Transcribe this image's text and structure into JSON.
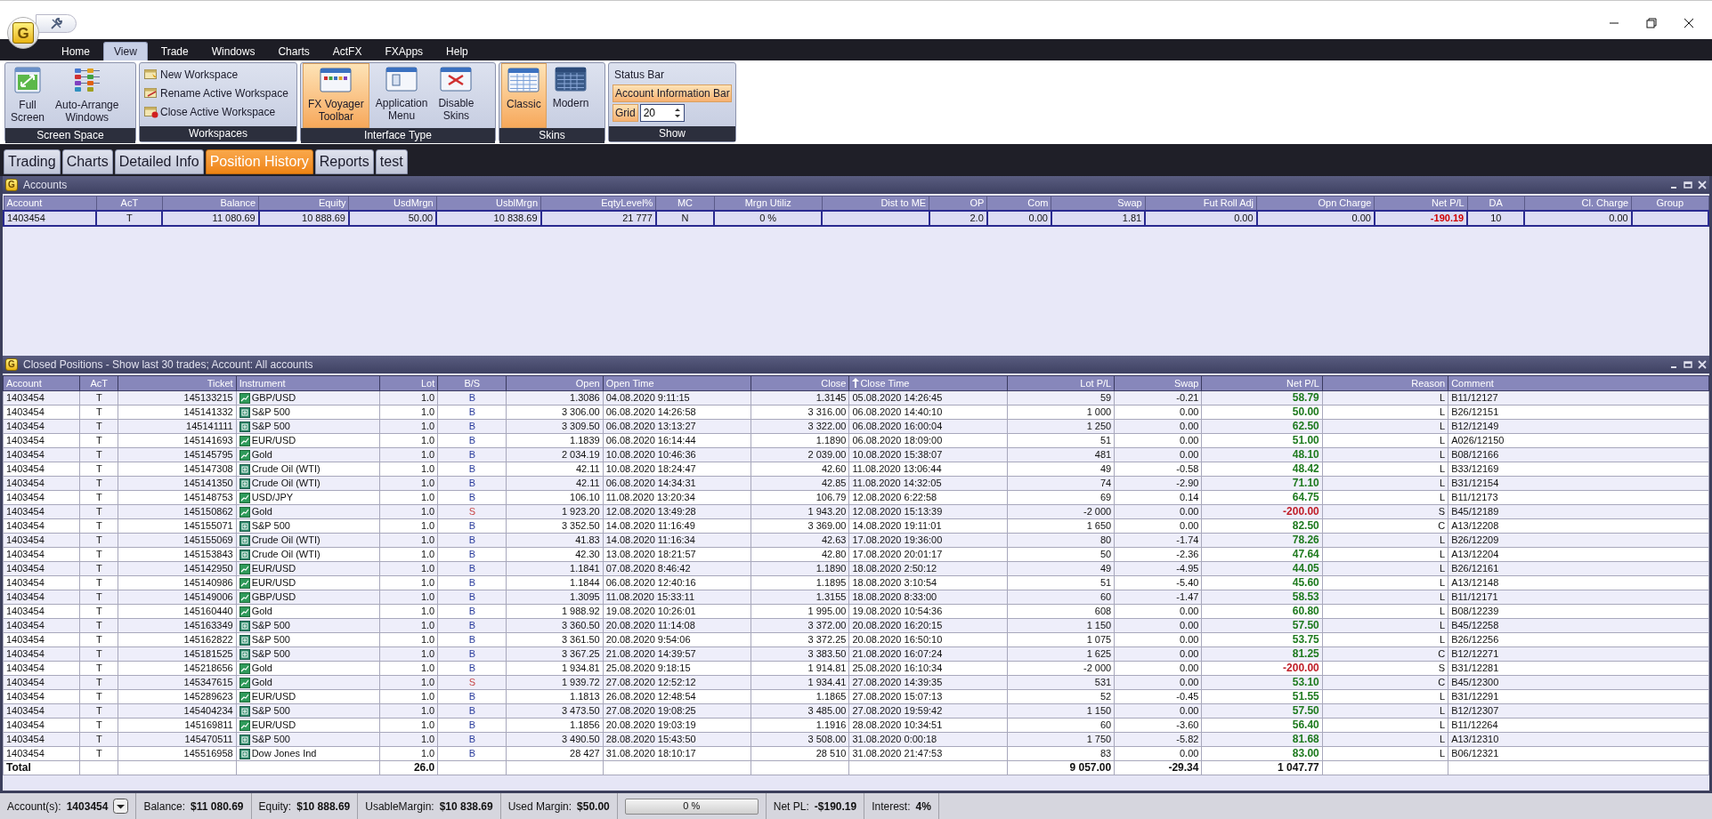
{
  "app_logo": "G",
  "menu": [
    {
      "label": "Home",
      "selected": false
    },
    {
      "label": "View",
      "selected": true
    },
    {
      "label": "Trade",
      "selected": false
    },
    {
      "label": "Windows",
      "selected": false
    },
    {
      "label": "Charts",
      "selected": false
    },
    {
      "label": "ActFX",
      "selected": false
    },
    {
      "label": "FXApps",
      "selected": false
    },
    {
      "label": "Help",
      "selected": false
    }
  ],
  "ribbon": {
    "screen_space": {
      "label": "Screen Space",
      "buttons": [
        "Full\nScreen",
        "Auto-Arrange\nWindows"
      ]
    },
    "workspaces": {
      "label": "Workspaces",
      "buttons": [
        "New Workspace",
        "Rename Active Workspace",
        "Close Active Workspace"
      ]
    },
    "interface_type": {
      "label": "Interface Type",
      "buttons": [
        {
          "label": "FX Voyager\nToolbar",
          "selected": true
        },
        {
          "label": "Application\nMenu",
          "selected": false
        },
        {
          "label": "Disable\nSkins",
          "selected": false
        }
      ]
    },
    "skins": {
      "label": "Skins",
      "buttons": [
        {
          "label": "Classic",
          "selected": true
        },
        {
          "label": "Modern",
          "selected": false
        }
      ]
    },
    "show": {
      "label": "Show",
      "toggles": [
        {
          "label": "Status Bar",
          "on": false
        },
        {
          "label": "Account Information Bar",
          "on": true
        }
      ],
      "grid": {
        "label": "Grid",
        "on": true,
        "value": "20"
      }
    }
  },
  "tabs": [
    {
      "label": "Trading",
      "selected": false
    },
    {
      "label": "Charts",
      "selected": false
    },
    {
      "label": "Detailed Info",
      "selected": false
    },
    {
      "label": "Position History",
      "selected": true
    },
    {
      "label": "Reports",
      "selected": false
    },
    {
      "label": "test",
      "selected": false
    }
  ],
  "accounts": {
    "title": "Accounts",
    "logo": "G",
    "columns": [
      "Account",
      "AcT",
      "Balance",
      "Equity",
      "UsdMrgn",
      "UsblMrgn",
      "EqtyLevel%",
      "MC",
      "Mrgn Utiliz",
      "Dist to ME",
      "OP",
      "Com",
      "Swap",
      "Fut Roll Adj",
      "Opn Charge",
      "Net P/L",
      "DA",
      "Cl. Charge",
      "Group"
    ],
    "rows": [
      {
        "selected": true,
        "loss": true,
        "cells": [
          "1403454",
          "T",
          "11 080.69",
          "10 888.69",
          "50.00",
          "10 838.69",
          "21 777",
          "N",
          "0 %",
          "",
          "2.0",
          "0.00",
          "1.81",
          "0.00",
          "0.00",
          "-190.19",
          "10",
          "0.00",
          ""
        ]
      }
    ]
  },
  "closed_positions": {
    "title": "Closed Positions - Show last 30 trades; Account: All accounts",
    "logo": "G",
    "columns": [
      {
        "label": "Account",
        "sorted": false
      },
      {
        "label": "AcT",
        "sorted": false
      },
      {
        "label": "Ticket",
        "sorted": false
      },
      {
        "label": "Instrument",
        "sorted": false
      },
      {
        "label": "Lot",
        "sorted": false
      },
      {
        "label": "B/S",
        "sorted": false
      },
      {
        "label": "Open",
        "sorted": false
      },
      {
        "label": "Open Time",
        "sorted": false
      },
      {
        "label": "Close",
        "sorted": false
      },
      {
        "label": "Close Time",
        "sorted": true
      },
      {
        "label": "Lot P/L",
        "sorted": false
      },
      {
        "label": "Swap",
        "sorted": false
      },
      {
        "label": "Net P/L",
        "sorted": false
      },
      {
        "label": "Reason",
        "sorted": false
      },
      {
        "label": "Comment",
        "sorted": false
      }
    ],
    "rows": [
      {
        "account": "1403454",
        "act": "T",
        "ticket": "145133215",
        "instrument": "GBP/USD",
        "kind": "fx",
        "lot": "1.0",
        "side": "B",
        "sell": false,
        "open": "1.3086",
        "open_time": "04.08.2020 9:11:15",
        "close": "1.3145",
        "close_time": "05.08.2020 14:26:45",
        "lot_pl": "59",
        "swap": "-0.21",
        "net_pl": "58.79",
        "loss": false,
        "reason": "L",
        "comment": "B11/12127"
      },
      {
        "account": "1403454",
        "act": "T",
        "ticket": "145141332",
        "instrument": "S&P 500",
        "kind": "cfd",
        "lot": "1.0",
        "side": "B",
        "sell": false,
        "open": "3 306.00",
        "open_time": "06.08.2020 14:26:58",
        "close": "3 316.00",
        "close_time": "06.08.2020 14:40:10",
        "lot_pl": "1 000",
        "swap": "0.00",
        "net_pl": "50.00",
        "loss": false,
        "reason": "L",
        "comment": "B26/12151"
      },
      {
        "account": "1403454",
        "act": "T",
        "ticket": "145141111",
        "instrument": "S&P 500",
        "kind": "cfd",
        "lot": "1.0",
        "side": "B",
        "sell": false,
        "open": "3 309.50",
        "open_time": "06.08.2020 13:13:27",
        "close": "3 322.00",
        "close_time": "06.08.2020 16:00:04",
        "lot_pl": "1 250",
        "swap": "0.00",
        "net_pl": "62.50",
        "loss": false,
        "reason": "L",
        "comment": "B12/12149"
      },
      {
        "account": "1403454",
        "act": "T",
        "ticket": "145141693",
        "instrument": "EUR/USD",
        "kind": "fx",
        "lot": "1.0",
        "side": "B",
        "sell": false,
        "open": "1.1839",
        "open_time": "06.08.2020 16:14:44",
        "close": "1.1890",
        "close_time": "06.08.2020 18:09:00",
        "lot_pl": "51",
        "swap": "0.00",
        "net_pl": "51.00",
        "loss": false,
        "reason": "L",
        "comment": "A026/12150"
      },
      {
        "account": "1403454",
        "act": "T",
        "ticket": "145145795",
        "instrument": "Gold",
        "kind": "fx",
        "lot": "1.0",
        "side": "B",
        "sell": false,
        "open": "2 034.19",
        "open_time": "10.08.2020 10:46:36",
        "close": "2 039.00",
        "close_time": "10.08.2020 15:38:07",
        "lot_pl": "481",
        "swap": "0.00",
        "net_pl": "48.10",
        "loss": false,
        "reason": "L",
        "comment": "B08/12166"
      },
      {
        "account": "1403454",
        "act": "T",
        "ticket": "145147308",
        "instrument": "Crude Oil (WTI)",
        "kind": "cfd",
        "lot": "1.0",
        "side": "B",
        "sell": false,
        "open": "42.11",
        "open_time": "10.08.2020 18:24:47",
        "close": "42.60",
        "close_time": "11.08.2020 13:06:44",
        "lot_pl": "49",
        "swap": "-0.58",
        "net_pl": "48.42",
        "loss": false,
        "reason": "L",
        "comment": "B33/12169"
      },
      {
        "account": "1403454",
        "act": "T",
        "ticket": "145141350",
        "instrument": "Crude Oil (WTI)",
        "kind": "cfd",
        "lot": "1.0",
        "side": "B",
        "sell": false,
        "open": "42.11",
        "open_time": "06.08.2020 14:34:31",
        "close": "42.85",
        "close_time": "11.08.2020 14:32:05",
        "lot_pl": "74",
        "swap": "-2.90",
        "net_pl": "71.10",
        "loss": false,
        "reason": "L",
        "comment": "B31/12154"
      },
      {
        "account": "1403454",
        "act": "T",
        "ticket": "145148753",
        "instrument": "USD/JPY",
        "kind": "fx",
        "lot": "1.0",
        "side": "B",
        "sell": false,
        "open": "106.10",
        "open_time": "11.08.2020 13:20:34",
        "close": "106.79",
        "close_time": "12.08.2020 6:22:58",
        "lot_pl": "69",
        "swap": "0.14",
        "net_pl": "64.75",
        "loss": false,
        "reason": "L",
        "comment": "B11/12173"
      },
      {
        "account": "1403454",
        "act": "T",
        "ticket": "145150862",
        "instrument": "Gold",
        "kind": "fx",
        "lot": "1.0",
        "side": "S",
        "sell": true,
        "open": "1 923.20",
        "open_time": "12.08.2020 13:49:28",
        "close": "1 943.20",
        "close_time": "12.08.2020 15:13:39",
        "lot_pl": "-2 000",
        "swap": "0.00",
        "net_pl": "-200.00",
        "loss": true,
        "reason": "S",
        "comment": "B45/12189"
      },
      {
        "account": "1403454",
        "act": "T",
        "ticket": "145155071",
        "instrument": "S&P 500",
        "kind": "cfd",
        "lot": "1.0",
        "side": "B",
        "sell": false,
        "open": "3 352.50",
        "open_time": "14.08.2020 11:16:49",
        "close": "3 369.00",
        "close_time": "14.08.2020 19:11:01",
        "lot_pl": "1 650",
        "swap": "0.00",
        "net_pl": "82.50",
        "loss": false,
        "reason": "C",
        "comment": "A13/12208"
      },
      {
        "account": "1403454",
        "act": "T",
        "ticket": "145155069",
        "instrument": "Crude Oil (WTI)",
        "kind": "cfd",
        "lot": "1.0",
        "side": "B",
        "sell": false,
        "open": "41.83",
        "open_time": "14.08.2020 11:16:34",
        "close": "42.63",
        "close_time": "17.08.2020 19:36:00",
        "lot_pl": "80",
        "swap": "-1.74",
        "net_pl": "78.26",
        "loss": false,
        "reason": "L",
        "comment": "B26/12209"
      },
      {
        "account": "1403454",
        "act": "T",
        "ticket": "145153843",
        "instrument": "Crude Oil (WTI)",
        "kind": "cfd",
        "lot": "1.0",
        "side": "B",
        "sell": false,
        "open": "42.30",
        "open_time": "13.08.2020 18:21:57",
        "close": "42.80",
        "close_time": "17.08.2020 20:01:17",
        "lot_pl": "50",
        "swap": "-2.36",
        "net_pl": "47.64",
        "loss": false,
        "reason": "L",
        "comment": "A13/12204"
      },
      {
        "account": "1403454",
        "act": "T",
        "ticket": "145142950",
        "instrument": "EUR/USD",
        "kind": "fx",
        "lot": "1.0",
        "side": "B",
        "sell": false,
        "open": "1.1841",
        "open_time": "07.08.2020 8:46:42",
        "close": "1.1890",
        "close_time": "18.08.2020 2:50:12",
        "lot_pl": "49",
        "swap": "-4.95",
        "net_pl": "44.05",
        "loss": false,
        "reason": "L",
        "comment": "B26/12161"
      },
      {
        "account": "1403454",
        "act": "T",
        "ticket": "145140986",
        "instrument": "EUR/USD",
        "kind": "fx",
        "lot": "1.0",
        "side": "B",
        "sell": false,
        "open": "1.1844",
        "open_time": "06.08.2020 12:40:16",
        "close": "1.1895",
        "close_time": "18.08.2020 3:10:54",
        "lot_pl": "51",
        "swap": "-5.40",
        "net_pl": "45.60",
        "loss": false,
        "reason": "L",
        "comment": "A13/12148"
      },
      {
        "account": "1403454",
        "act": "T",
        "ticket": "145149006",
        "instrument": "GBP/USD",
        "kind": "fx",
        "lot": "1.0",
        "side": "B",
        "sell": false,
        "open": "1.3095",
        "open_time": "11.08.2020 15:33:11",
        "close": "1.3155",
        "close_time": "18.08.2020 8:33:00",
        "lot_pl": "60",
        "swap": "-1.47",
        "net_pl": "58.53",
        "loss": false,
        "reason": "L",
        "comment": "B11/12171"
      },
      {
        "account": "1403454",
        "act": "T",
        "ticket": "145160440",
        "instrument": "Gold",
        "kind": "fx",
        "lot": "1.0",
        "side": "B",
        "sell": false,
        "open": "1 988.92",
        "open_time": "19.08.2020 10:26:01",
        "close": "1 995.00",
        "close_time": "19.08.2020 10:54:36",
        "lot_pl": "608",
        "swap": "0.00",
        "net_pl": "60.80",
        "loss": false,
        "reason": "L",
        "comment": "B08/12239"
      },
      {
        "account": "1403454",
        "act": "T",
        "ticket": "145163349",
        "instrument": "S&P 500",
        "kind": "cfd",
        "lot": "1.0",
        "side": "B",
        "sell": false,
        "open": "3 360.50",
        "open_time": "20.08.2020 11:14:08",
        "close": "3 372.00",
        "close_time": "20.08.2020 16:20:15",
        "lot_pl": "1 150",
        "swap": "0.00",
        "net_pl": "57.50",
        "loss": false,
        "reason": "L",
        "comment": "B45/12258"
      },
      {
        "account": "1403454",
        "act": "T",
        "ticket": "145162822",
        "instrument": "S&P 500",
        "kind": "cfd",
        "lot": "1.0",
        "side": "B",
        "sell": false,
        "open": "3 361.50",
        "open_time": "20.08.2020 9:54:06",
        "close": "3 372.25",
        "close_time": "20.08.2020 16:50:10",
        "lot_pl": "1 075",
        "swap": "0.00",
        "net_pl": "53.75",
        "loss": false,
        "reason": "L",
        "comment": "B26/12256"
      },
      {
        "account": "1403454",
        "act": "T",
        "ticket": "145181525",
        "instrument": "S&P 500",
        "kind": "cfd",
        "lot": "1.0",
        "side": "B",
        "sell": false,
        "open": "3 367.25",
        "open_time": "21.08.2020 14:39:57",
        "close": "3 383.50",
        "close_time": "21.08.2020 16:07:24",
        "lot_pl": "1 625",
        "swap": "0.00",
        "net_pl": "81.25",
        "loss": false,
        "reason": "C",
        "comment": "B12/12271"
      },
      {
        "account": "1403454",
        "act": "T",
        "ticket": "145218656",
        "instrument": "Gold",
        "kind": "fx",
        "lot": "1.0",
        "side": "B",
        "sell": false,
        "open": "1 934.81",
        "open_time": "25.08.2020 9:18:15",
        "close": "1 914.81",
        "close_time": "25.08.2020 16:10:34",
        "lot_pl": "-2 000",
        "swap": "0.00",
        "net_pl": "-200.00",
        "loss": true,
        "reason": "S",
        "comment": "B31/12281"
      },
      {
        "account": "1403454",
        "act": "T",
        "ticket": "145347615",
        "instrument": "Gold",
        "kind": "fx",
        "lot": "1.0",
        "side": "S",
        "sell": true,
        "open": "1 939.72",
        "open_time": "27.08.2020 12:52:12",
        "close": "1 934.41",
        "close_time": "27.08.2020 14:39:35",
        "lot_pl": "531",
        "swap": "0.00",
        "net_pl": "53.10",
        "loss": false,
        "reason": "C",
        "comment": "B45/12300"
      },
      {
        "account": "1403454",
        "act": "T",
        "ticket": "145289623",
        "instrument": "EUR/USD",
        "kind": "fx",
        "lot": "1.0",
        "side": "B",
        "sell": false,
        "open": "1.1813",
        "open_time": "26.08.2020 12:48:54",
        "close": "1.1865",
        "close_time": "27.08.2020 15:07:13",
        "lot_pl": "52",
        "swap": "-0.45",
        "net_pl": "51.55",
        "loss": false,
        "reason": "L",
        "comment": "B31/12291"
      },
      {
        "account": "1403454",
        "act": "T",
        "ticket": "145404234",
        "instrument": "S&P 500",
        "kind": "cfd",
        "lot": "1.0",
        "side": "B",
        "sell": false,
        "open": "3 473.50",
        "open_time": "27.08.2020 19:08:25",
        "close": "3 485.00",
        "close_time": "27.08.2020 19:59:42",
        "lot_pl": "1 150",
        "swap": "0.00",
        "net_pl": "57.50",
        "loss": false,
        "reason": "L",
        "comment": "B12/12307"
      },
      {
        "account": "1403454",
        "act": "T",
        "ticket": "145169811",
        "instrument": "EUR/USD",
        "kind": "fx",
        "lot": "1.0",
        "side": "B",
        "sell": false,
        "open": "1.1856",
        "open_time": "20.08.2020 19:03:19",
        "close": "1.1916",
        "close_time": "28.08.2020 10:34:51",
        "lot_pl": "60",
        "swap": "-3.60",
        "net_pl": "56.40",
        "loss": false,
        "reason": "L",
        "comment": "B11/12264"
      },
      {
        "account": "1403454",
        "act": "T",
        "ticket": "145470511",
        "instrument": "S&P 500",
        "kind": "cfd",
        "lot": "1.0",
        "side": "B",
        "sell": false,
        "open": "3 490.50",
        "open_time": "28.08.2020 15:43:50",
        "close": "3 508.00",
        "close_time": "31.08.2020 0:00:18",
        "lot_pl": "1 750",
        "swap": "-5.82",
        "net_pl": "81.68",
        "loss": false,
        "reason": "L",
        "comment": "A13/12310"
      },
      {
        "account": "1403454",
        "act": "T",
        "ticket": "145516958",
        "instrument": "Dow Jones Ind",
        "kind": "cfd",
        "lot": "1.0",
        "side": "B",
        "sell": false,
        "open": "28 427",
        "open_time": "31.08.2020 18:10:17",
        "close": "28 510",
        "close_time": "31.08.2020 21:47:53",
        "lot_pl": "83",
        "swap": "0.00",
        "net_pl": "83.00",
        "loss": false,
        "reason": "L",
        "comment": "B06/12321"
      }
    ],
    "total": {
      "label": "Total",
      "lot": "26.0",
      "lot_pl": "9 057.00",
      "swap": "-29.34",
      "net_pl": "1 047.77"
    }
  },
  "status_bar": [
    {
      "kind": "dropdown",
      "label": "Account(s):",
      "value": "1403454"
    },
    {
      "kind": "text",
      "label": "Balance:",
      "value": "$11 080.69"
    },
    {
      "kind": "text",
      "label": "Equity:",
      "value": "$10 888.69"
    },
    {
      "kind": "text",
      "label": "UsableMargin:",
      "value": "$10 838.69"
    },
    {
      "kind": "text",
      "label": "Used Margin:",
      "value": "$50.00"
    },
    {
      "kind": "meter",
      "level": 0,
      "reading": "0 %"
    },
    {
      "kind": "text",
      "label": "Net PL:",
      "value": "-$190.19"
    },
    {
      "kind": "text",
      "label": "Interest:",
      "value": "4%"
    }
  ]
}
